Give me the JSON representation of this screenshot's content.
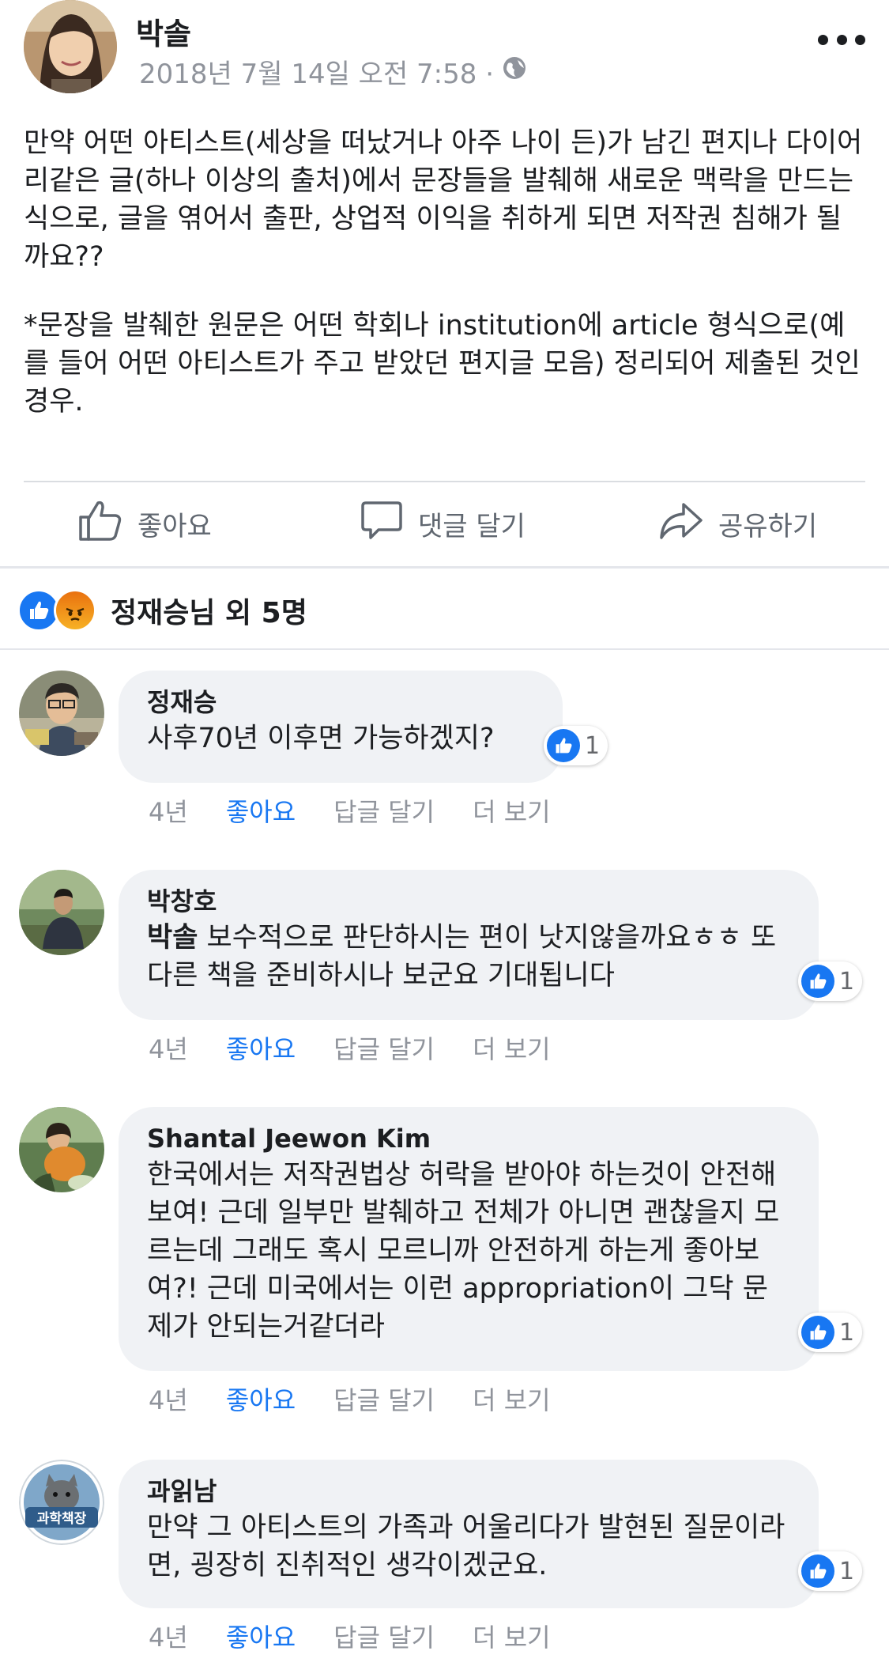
{
  "post": {
    "author": "박솔",
    "timestamp": "2018년 7월 14일 오전 7:58 ·",
    "privacy_icon": "globe-icon",
    "text_1": "만약 어떤 아티스트(세상을 떠났거나 아주 나이 든)가 남긴 편지나 다이어리같은 글(하나 이상의 출처)에서 문장들을 발췌해 새로운 맥락을 만드는 식으로, 글을 엮어서 출판, 상업적 이익을 취하게 되면 저작권 침해가 될까요??",
    "text_2": "*문장을 발췌한 원문은 어떤 학회나 institution에 article 형식으로(예를 들어 어떤 아티스트가 주고 받았던 편지글 모음) 정리되어 제출된 것인 경우."
  },
  "actions": {
    "like": "좋아요",
    "comment": "댓글 달기",
    "share": "공유하기"
  },
  "reactions": {
    "summary": "정재승님 외 5명"
  },
  "comments": [
    {
      "name": "정재승",
      "mention": "",
      "text": "사후70년 이후면 가능하겠지?",
      "likes": "1",
      "time": "4년",
      "like": "좋아요",
      "reply": "답글 달기",
      "more": "더 보기"
    },
    {
      "name": "박창호",
      "mention": "박솔",
      "text": " 보수적으로 판단하시는 편이 낫지않을까요ㅎㅎ 또다른 책을 준비하시나 보군요 기대됩니다",
      "likes": "1",
      "time": "4년",
      "like": "좋아요",
      "reply": "답글 달기",
      "more": "더 보기"
    },
    {
      "name": "Shantal Jeewon Kim",
      "mention": "",
      "text": "한국에서는 저작권법상 허락을 받아야 하는것이 안전해 보여! 근데 일부만 발췌하고 전체가 아니면 괜찮을지 모르는데 그래도 혹시 모르니까 안전하게 하는게 좋아보여?! 근데 미국에서는 이런 appropriation이 그닥 문제가 안되는거같더라",
      "likes": "1",
      "time": "4년",
      "like": "좋아요",
      "reply": "답글 달기",
      "more": "더 보기"
    },
    {
      "name": "과읽남",
      "mention": "",
      "text": "만약 그 아티스트의 가족과 어울리다가 발현된 질문이라면, 굉장히 진취적인 생각이겠군요.",
      "likes": "1",
      "time": "4년",
      "like": "좋아요",
      "reply": "답글 달기",
      "more": "더 보기"
    }
  ],
  "avatar4_badge": "과학책장",
  "colors": {
    "accent": "#1877f2",
    "meta": "#90949c",
    "bubble": "#f0f2f5"
  }
}
